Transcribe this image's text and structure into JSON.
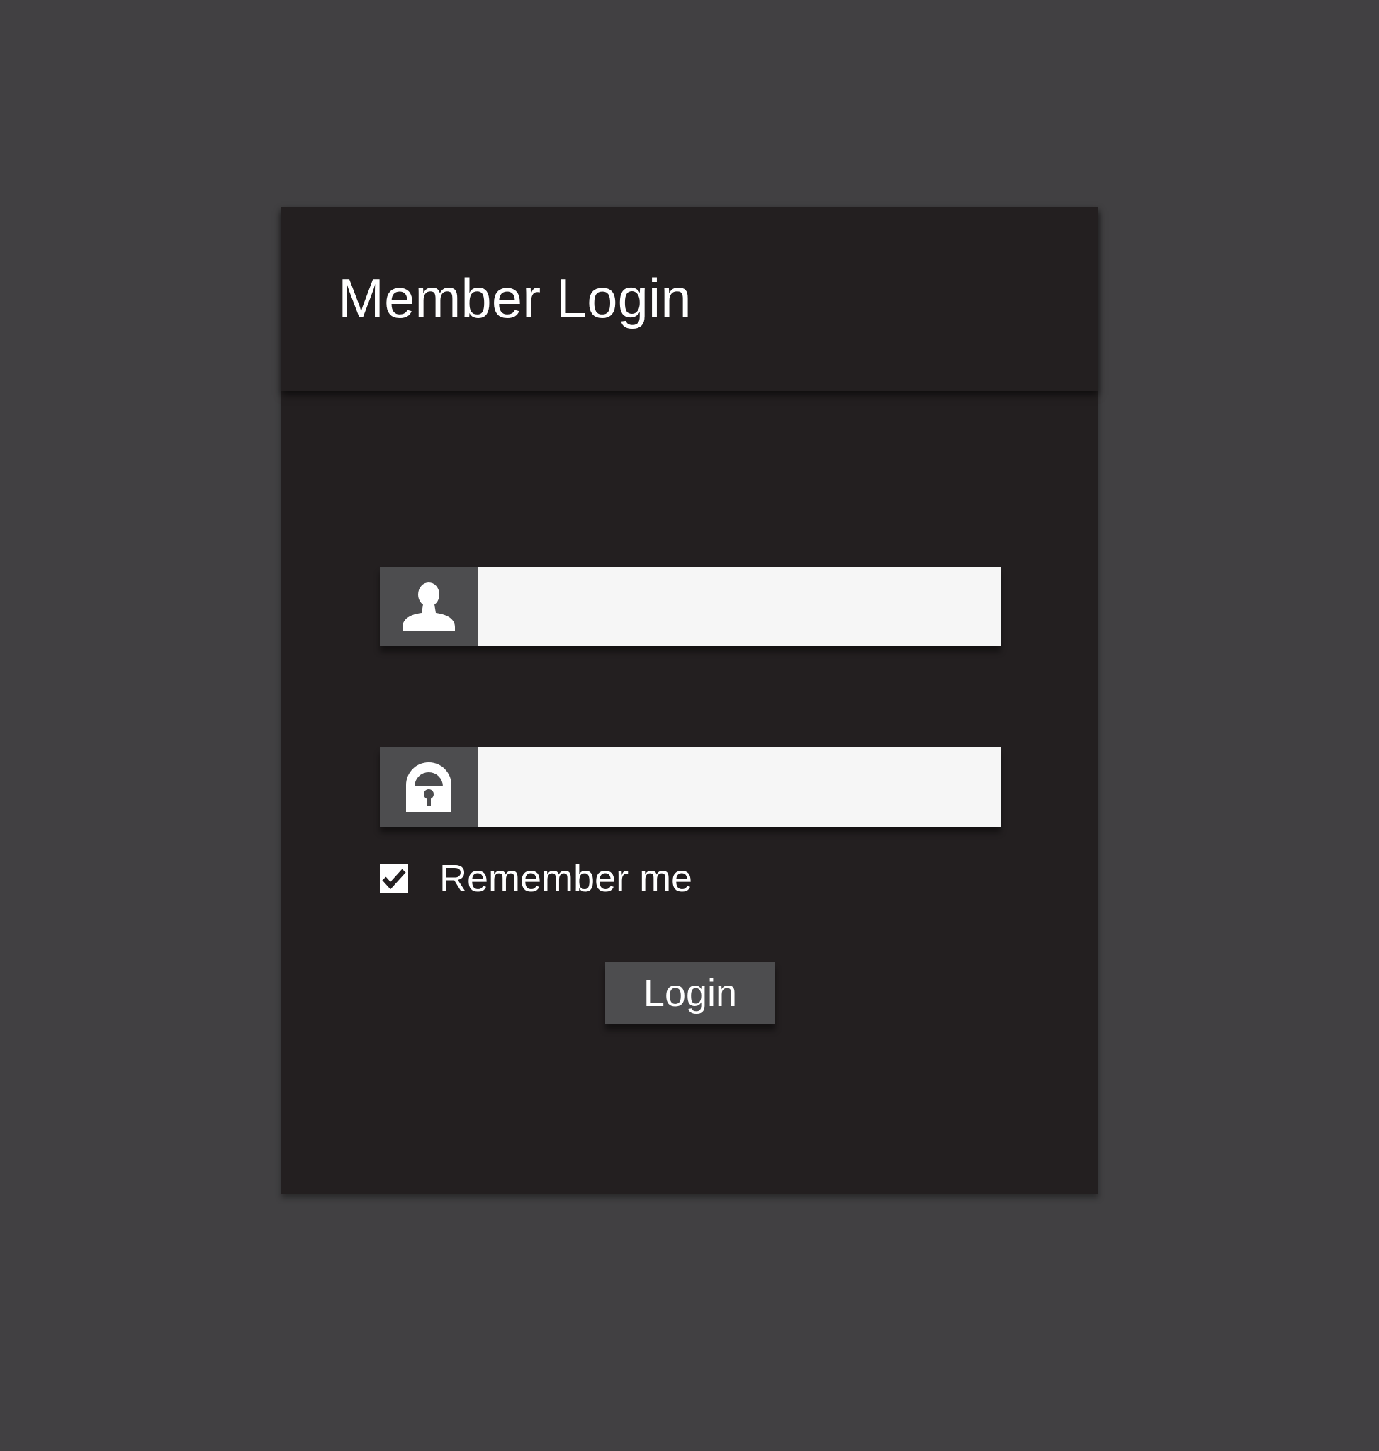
{
  "login_card": {
    "title": "Member Login",
    "username_field": {
      "icon": "user-icon",
      "value": "",
      "placeholder": ""
    },
    "password_field": {
      "icon": "lock-icon",
      "value": "",
      "placeholder": ""
    },
    "remember_me": {
      "label": "Remember me",
      "checked": true,
      "icon": "checkmark-icon"
    },
    "login_button": {
      "label": "Login"
    }
  },
  "colors": {
    "page_background": "#414042",
    "card_background": "#231f20",
    "icon_box": "#4d4d4f",
    "input_background": "#f6f6f6",
    "text": "#ffffff"
  }
}
